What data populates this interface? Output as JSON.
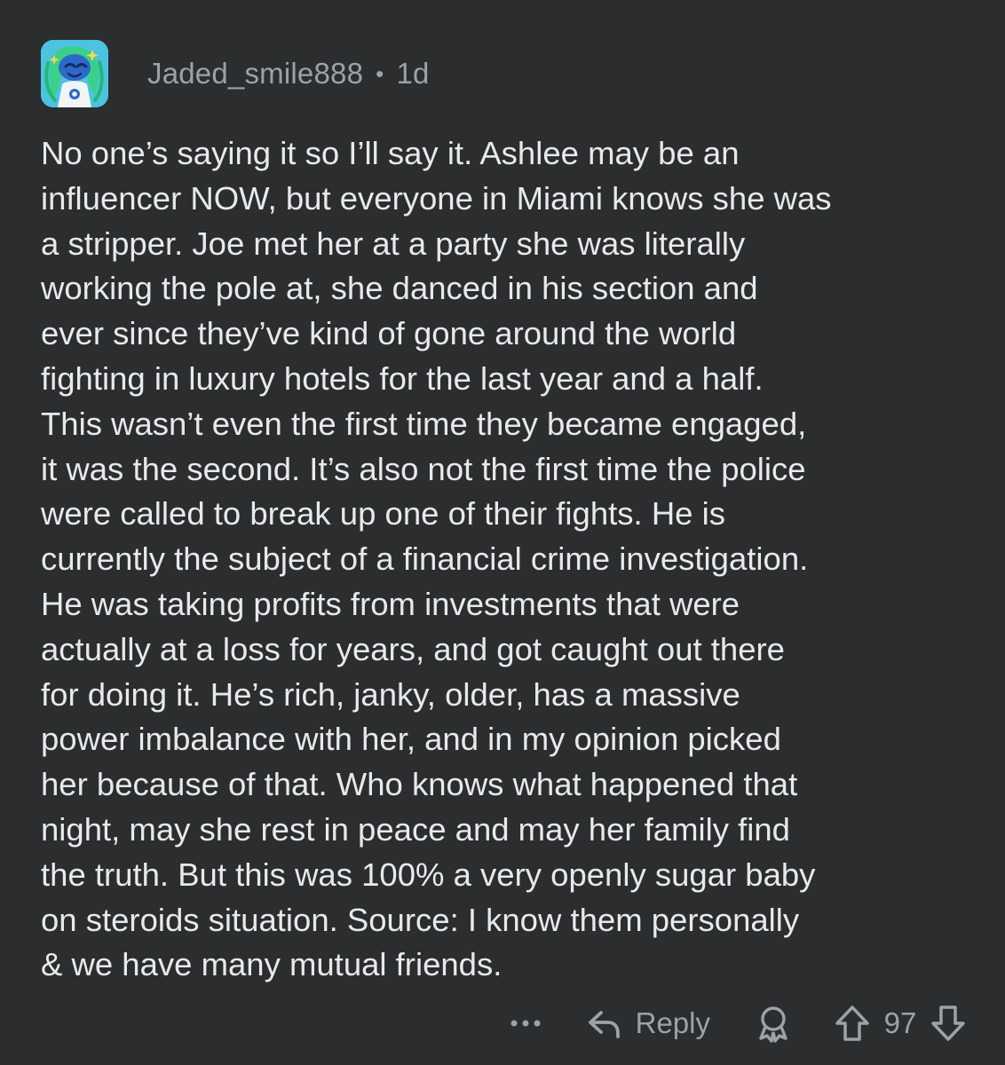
{
  "comment": {
    "author": "Jaded_smile888",
    "separator": "•",
    "time": "1d",
    "avatar_icon": "snoo-avatar-icon",
    "body": "No one’s saying it so I’ll say it. Ashlee may be an\ninfluencer NOW, but everyone in Miami knows she was\na stripper. Joe met her at a party she was literally\nworking the pole at, she danced in his section and\never since they’ve kind of gone around the world\nfighting in luxury hotels for the last year and a half.\nThis wasn’t even the first time they became engaged,\nit was the second. It’s also not the first time the police\nwere called to break up one of their fights. He is\ncurrently the subject of a financial crime investigation.\nHe was taking profits from investments that were\nactually at a loss for years, and got caught out there\nfor doing it. He’s rich, janky, older, has a massive\npower imbalance with her, and in my opinion picked\nher because of that. Who knows what happened that\nnight, may she rest in peace and may her family find\nthe truth. But this was 100% a very openly sugar baby\non steroids situation. Source: I know them personally\n& we have many mutual friends."
  },
  "actions": {
    "more_icon": "more-options-icon",
    "reply_icon": "reply-icon",
    "reply_label": "Reply",
    "award_icon": "award-icon",
    "upvote_icon": "upvote-icon",
    "score": "97",
    "downvote_icon": "downvote-icon"
  },
  "colors": {
    "background": "#2b2d2e",
    "text": "#e7eaec",
    "muted": "#9aa3a7",
    "avatar_bg": "#4cc3e0"
  }
}
